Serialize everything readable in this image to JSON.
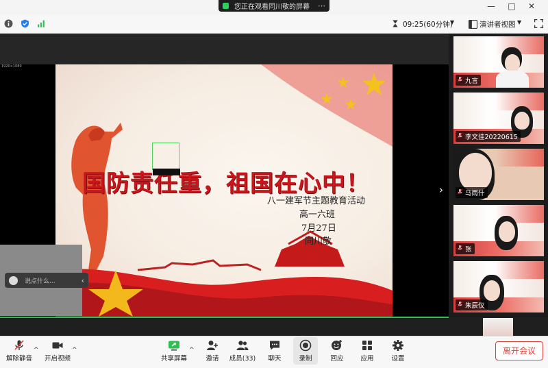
{
  "title_bar": {
    "share_status": "您正在观看同川敬的屏幕",
    "more": "⋯",
    "minimize": "—",
    "maximize": "□",
    "close": "✕"
  },
  "toolbar": {
    "timer": "09:25(60分钟)",
    "view_mode": "演讲者视图"
  },
  "slide": {
    "corner_label": "1920×1080",
    "title": "国防责任重，祖国在心中！",
    "subtitle": "八一建军节主题教育活动",
    "class_name": "高一六班",
    "date": "7月27日",
    "presenter": "同川敬"
  },
  "chat": {
    "placeholder": "说点什么..."
  },
  "participants": [
    {
      "name": "九言"
    },
    {
      "name": "李文佳20220615"
    },
    {
      "name": "马雨什"
    },
    {
      "name": "张"
    },
    {
      "name": "朱辰仪"
    }
  ],
  "bottom_bar": {
    "mute": "解除静音",
    "video": "开启视频",
    "share": "共享屏幕",
    "invite": "邀请",
    "members": "成员(33)",
    "chat": "聊天",
    "record": "录制",
    "reactions": "回应",
    "apps": "应用",
    "settings": "设置",
    "leave": "离开会议"
  },
  "colors": {
    "accent_green": "#2fbf55",
    "leave_red": "#e0413a",
    "title_red": "#c8161d"
  }
}
